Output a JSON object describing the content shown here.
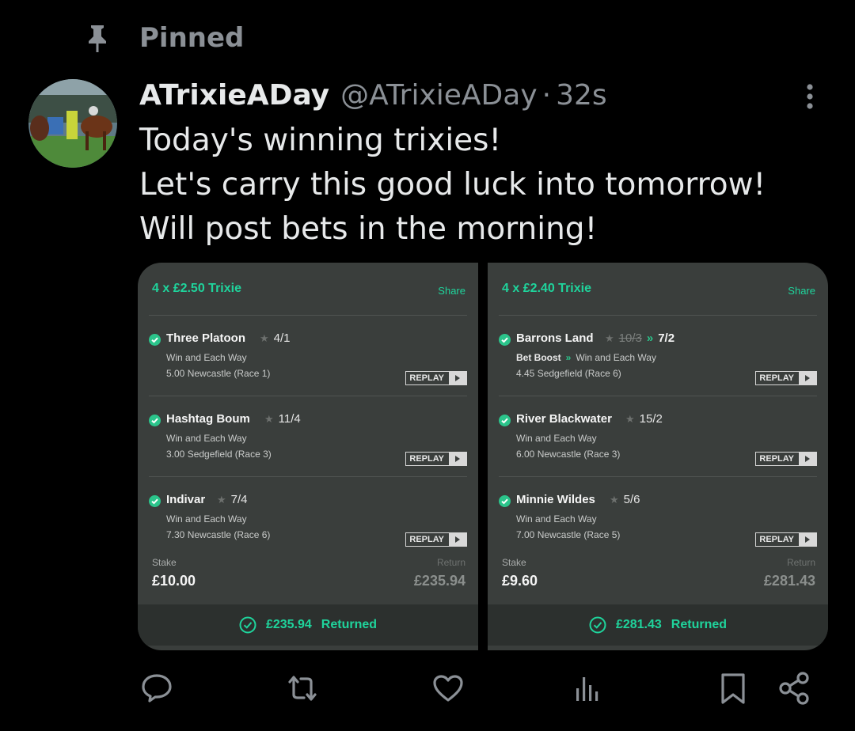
{
  "pinned": {
    "label": "Pinned"
  },
  "tweet": {
    "display_name": "ATrixieADay",
    "handle": "@ATrixieADay",
    "separator": "·",
    "time": "32s",
    "lines": [
      "Today's winning trixies!",
      "Let's carry this good luck into tomorrow!",
      "Will post bets in the morning!"
    ]
  },
  "slips": [
    {
      "title": "4 x £2.50 Trixie",
      "share": "Share",
      "selections": [
        {
          "horse": "Three Platoon",
          "odds": "4/1",
          "market": "Win and Each Way",
          "race": "5.00 Newcastle (Race 1)",
          "replay": "REPLAY"
        },
        {
          "horse": "Hashtag Boum",
          "odds": "11/4",
          "market": "Win and Each Way",
          "race": "3.00 Sedgefield (Race 3)",
          "replay": "REPLAY"
        },
        {
          "horse": "Indivar",
          "odds": "7/4",
          "market": "Win and Each Way",
          "race": "7.30 Newcastle (Race 6)",
          "replay": "REPLAY"
        }
      ],
      "stake_label": "Stake",
      "stake": "£10.00",
      "return_label": "Return",
      "return": "£235.94",
      "returned_amount": "£235.94",
      "returned_label": "Returned"
    },
    {
      "title": "4 x £2.40 Trixie",
      "share": "Share",
      "selections": [
        {
          "horse": "Barrons Land",
          "old_odds": "10/3",
          "odds": "7/2",
          "boost": "Bet Boost",
          "market": "Win and Each Way",
          "race": "4.45 Sedgefield (Race 6)",
          "replay": "REPLAY"
        },
        {
          "horse": "River Blackwater",
          "odds": "15/2",
          "market": "Win and Each Way",
          "race": "6.00 Newcastle (Race 3)",
          "replay": "REPLAY"
        },
        {
          "horse": "Minnie Wildes",
          "odds": "5/6",
          "market": "Win and Each Way",
          "race": "7.00 Newcastle (Race 5)",
          "replay": "REPLAY"
        }
      ],
      "stake_label": "Stake",
      "stake": "£9.60",
      "return_label": "Return",
      "return": "£281.43",
      "returned_amount": "£281.43",
      "returned_label": "Returned"
    }
  ],
  "icons": {
    "pin": "pin-icon",
    "more": "more-icon",
    "reply": "reply-icon",
    "retweet": "retweet-icon",
    "like": "heart-icon",
    "views": "views-icon",
    "bookmark": "bookmark-icon",
    "share": "share-icon"
  },
  "colors": {
    "background": "#000000",
    "text": "#e7e9ea",
    "muted": "#8b9096",
    "accent_green": "#1fd49c",
    "slip_bg": "#3a3e3c"
  }
}
